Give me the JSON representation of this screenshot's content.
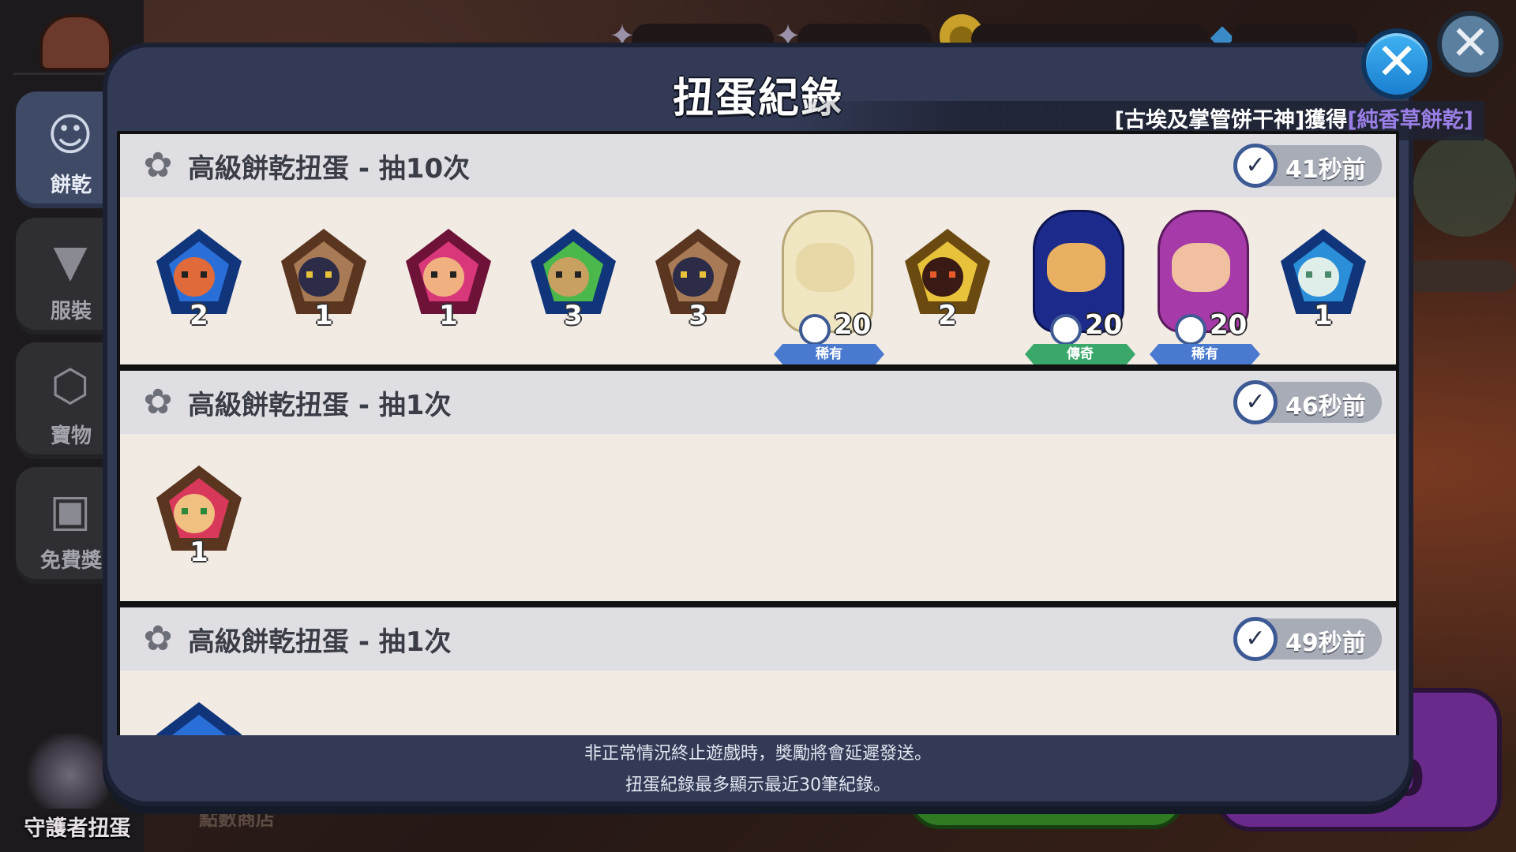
{
  "sidebar": {
    "items": [
      {
        "label": "餅乾",
        "icon": "cookie-icon",
        "active": true
      },
      {
        "label": "服裝",
        "icon": "shirt-icon",
        "active": false
      },
      {
        "label": "寶物",
        "icon": "treasure-icon",
        "active": false
      },
      {
        "label": "免費獎",
        "icon": "gift-icon",
        "active": false
      }
    ],
    "guardian_label": "守護者扭蛋"
  },
  "background": {
    "points_shop": "點數商店",
    "big_button_digit": "0"
  },
  "modal": {
    "title": "扭蛋紀錄",
    "close_label": "✕",
    "ticker": {
      "prefix": "[古埃及掌管饼干神]獲得",
      "highlight": "[純香草餅乾]"
    },
    "footer_line1": "非正常情況終止遊戲時，獎勵將會延遲發送。",
    "footer_line2": "扭蛋紀錄最多顯示最近30筆紀錄。"
  },
  "records": [
    {
      "title": "高級餅乾扭蛋 - 抽10次",
      "time": "41秒前",
      "items": [
        {
          "type": "soulstone",
          "count": "2",
          "color": "#2a6fd8"
        },
        {
          "type": "soulstone",
          "count": "1",
          "color": "#8a5a3a"
        },
        {
          "type": "soulstone",
          "count": "1",
          "color": "#c8286a"
        },
        {
          "type": "soulstone",
          "count": "3",
          "color": "#2a8fd8"
        },
        {
          "type": "soulstone",
          "count": "3",
          "color": "#8a5a3a"
        },
        {
          "type": "cookie",
          "count": "20",
          "rarity": "稀有",
          "color": "#f0e6c2"
        },
        {
          "type": "soulstone",
          "count": "2",
          "color": "#b8892a"
        },
        {
          "type": "cookie",
          "count": "20",
          "rarity": "傳奇",
          "color": "#1c2a8c"
        },
        {
          "type": "cookie",
          "count": "20",
          "rarity": "稀有",
          "color": "#a53aa8"
        },
        {
          "type": "soulstone",
          "count": "1",
          "color": "#2a6fd8"
        }
      ]
    },
    {
      "title": "高級餅乾扭蛋 - 抽1次",
      "time": "46秒前",
      "items": [
        {
          "type": "soulstone",
          "count": "1",
          "color": "#8a5a3a"
        }
      ]
    },
    {
      "title": "高級餅乾扭蛋 - 抽1次",
      "time": "49秒前",
      "items": [
        {
          "type": "soulstone",
          "count": "",
          "color": "#2a6fd8"
        }
      ]
    }
  ]
}
